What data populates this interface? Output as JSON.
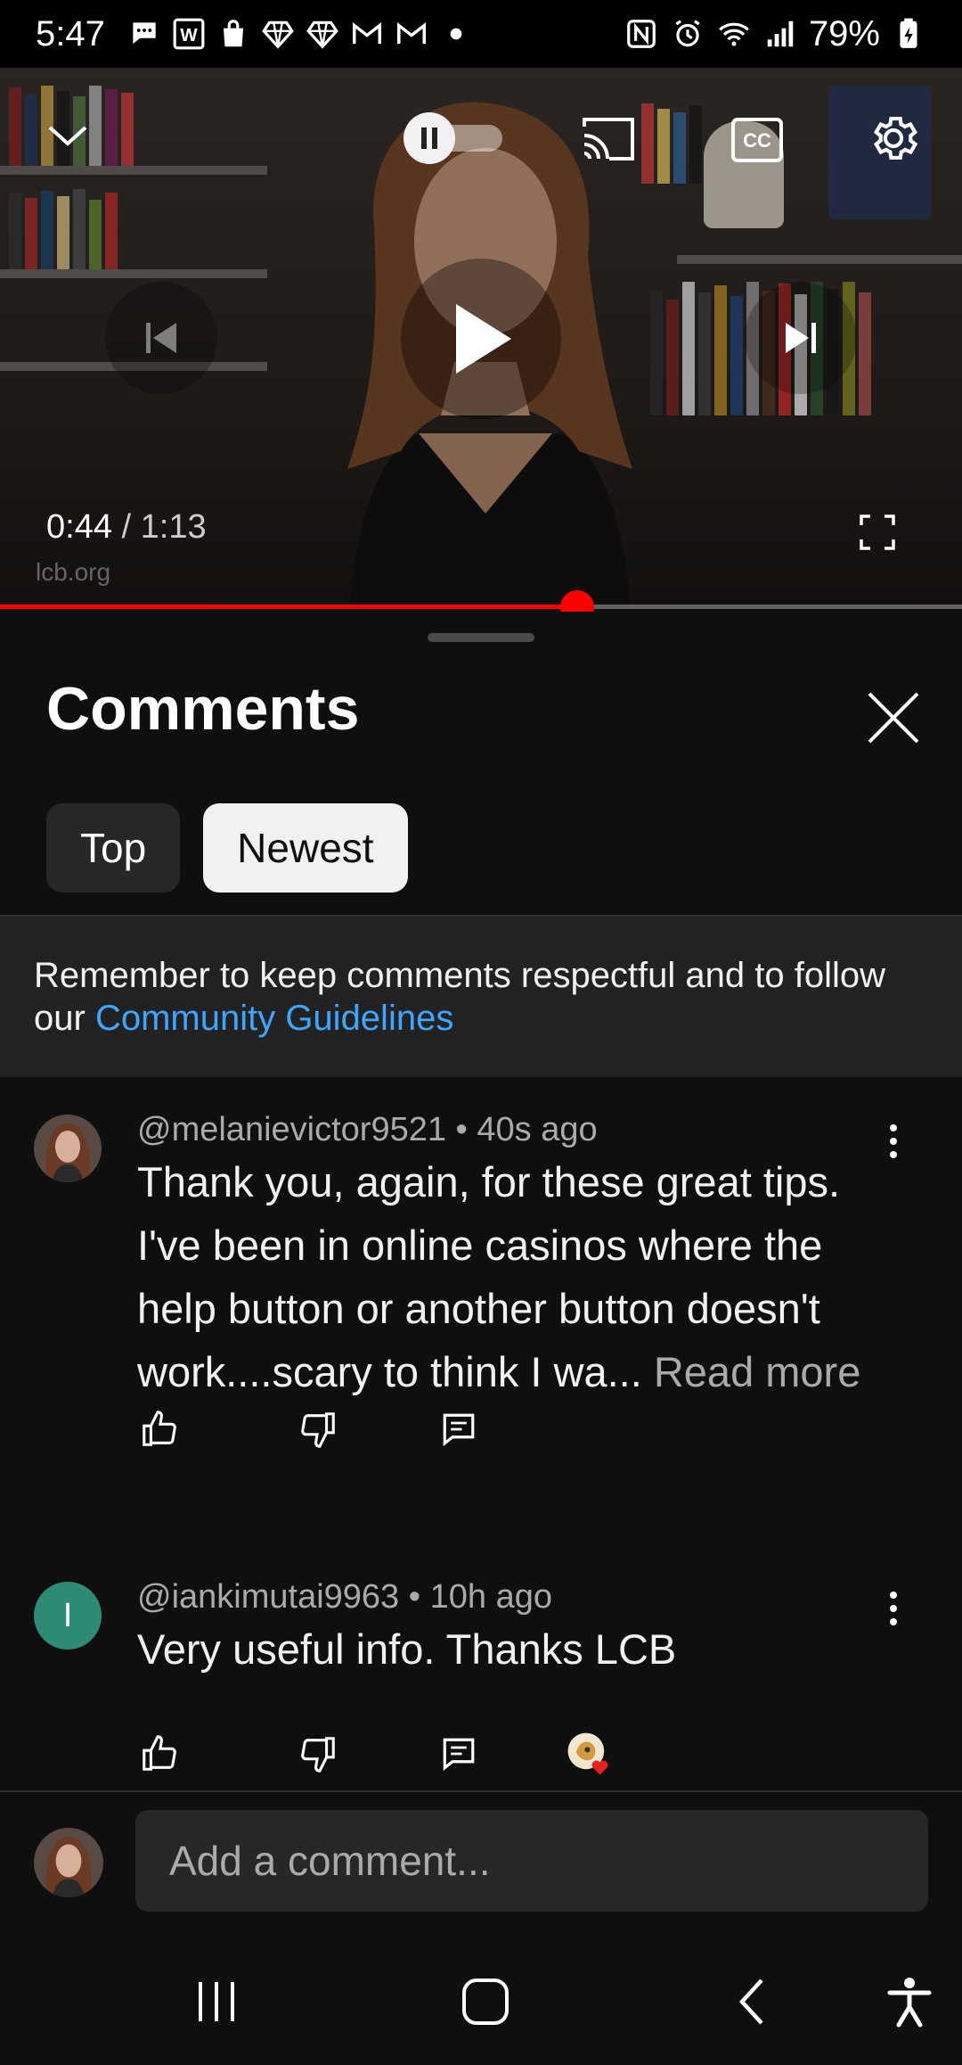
{
  "status_bar": {
    "time": "5:47",
    "battery": "79%",
    "left_icons": [
      "chat-bubble-icon",
      "w-app-icon",
      "shopping-bag-icon",
      "diamond-icon",
      "diamond-icon",
      "gmail-icon",
      "gmail-icon",
      "dot-icon"
    ],
    "right_icons": [
      "nfc-icon",
      "alarm-icon",
      "wifi-icon",
      "signal-icon",
      "battery-charging-icon"
    ]
  },
  "player": {
    "current_time": "0:44",
    "separator": " / ",
    "duration": "1:13",
    "watermark": "lcb.org",
    "progress": 0.6,
    "controls": [
      "collapse-icon",
      "autoplay-toggle",
      "cast-icon",
      "captions-icon",
      "settings-icon",
      "previous-icon",
      "play-icon",
      "next-icon",
      "fullscreen-icon"
    ]
  },
  "comments_sheet": {
    "title": "Comments",
    "tabs": [
      {
        "label": "Top",
        "selected": false
      },
      {
        "label": "Newest",
        "selected": true
      }
    ],
    "notice_text": "Remember to keep comments respectful and to follow our ",
    "notice_link": "Community Guidelines",
    "comments": [
      {
        "meta": "@melanievictor9521 • 40s ago",
        "text": "Thank you, again, for these great tips. I've been in online casinos where the help button or another button doesn't work....scary to think I wa... ",
        "read_more": "Read more"
      },
      {
        "avatar_initial": "I",
        "meta": "@iankimutai9963 • 10h ago",
        "text": "Very useful info. Thanks LCB",
        "creator_heart": true
      }
    ],
    "add_comment_placeholder": "Add a comment..."
  },
  "nav_bar": {
    "buttons": [
      "recent-apps-icon",
      "home-icon",
      "back-icon",
      "accessibility-icon"
    ]
  },
  "colors": {
    "background": "#0f0f0f",
    "accent_red": "#ff0000",
    "link_blue": "#3ea6ff",
    "chip_inactive": "#272727",
    "chip_active": "#f1f1f1",
    "avatar_green": "#2e8b76"
  }
}
